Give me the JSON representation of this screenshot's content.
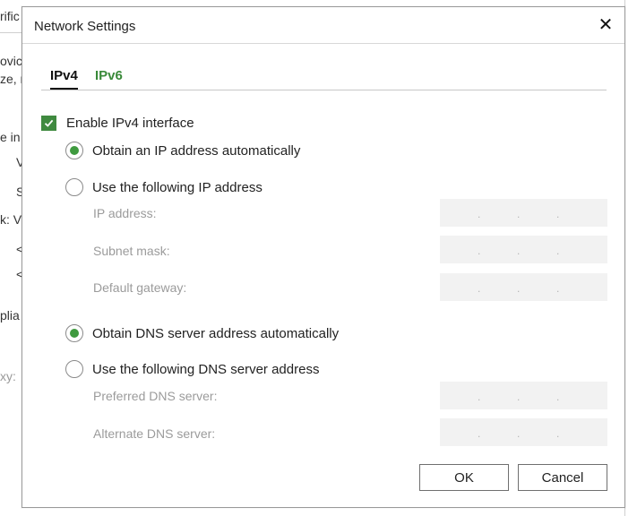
{
  "background": {
    "fragments": [
      "rific",
      "ovic",
      "ze, r",
      "e in",
      "V",
      "S",
      "k:  V",
      "<",
      "<",
      "plia",
      "xy:"
    ]
  },
  "dialog": {
    "title": "Network Settings",
    "close_icon": "close-icon",
    "tabs": [
      {
        "label": "IPv4",
        "active": true
      },
      {
        "label": "IPv6",
        "active": false
      }
    ],
    "enable_ipv4": {
      "label": "Enable IPv4 interface",
      "checked": true
    },
    "ip_mode": {
      "auto_label": "Obtain an IP address automatically",
      "manual_label": "Use the following IP address",
      "selected": "auto"
    },
    "ip_fields": [
      {
        "label": "IP address:",
        "value": ".   .   ."
      },
      {
        "label": "Subnet mask:",
        "value": ".   .   ."
      },
      {
        "label": "Default gateway:",
        "value": ".   .   ."
      }
    ],
    "dns_mode": {
      "auto_label": "Obtain DNS server address automatically",
      "manual_label": "Use the following DNS server address",
      "selected": "auto"
    },
    "dns_fields": [
      {
        "label": "Preferred DNS server:",
        "value": ".   .   ."
      },
      {
        "label": "Alternate DNS server:",
        "value": ".   .   ."
      }
    ],
    "buttons": {
      "ok": "OK",
      "cancel": "Cancel"
    },
    "colors": {
      "accent": "#3f9a3f",
      "tab_inactive": "#3a8a3a"
    }
  }
}
